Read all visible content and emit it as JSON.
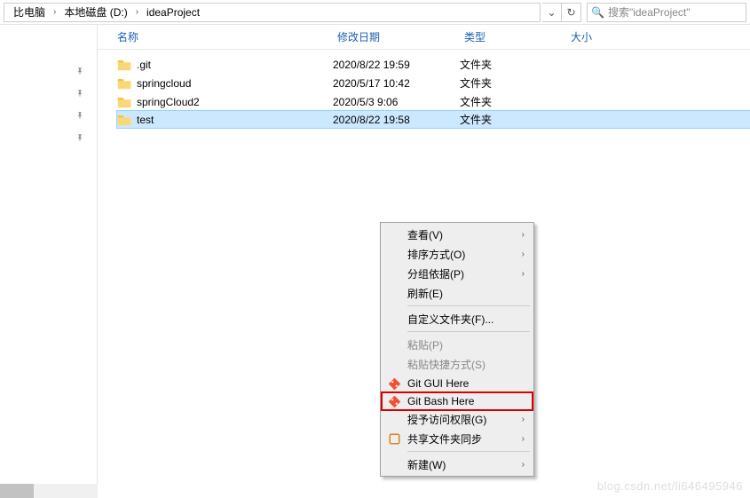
{
  "breadcrumbs": {
    "pc": "比电脑",
    "drive": "本地磁盘 (D:)",
    "folder": "ideaProject"
  },
  "search": {
    "placeholder": "搜索\"ideaProject\""
  },
  "headers": {
    "name": "名称",
    "date": "修改日期",
    "type": "类型",
    "size": "大小"
  },
  "files": [
    {
      "name": ".git",
      "date": "2020/8/22 19:59",
      "type": "文件夹"
    },
    {
      "name": "springcloud",
      "date": "2020/5/17 10:42",
      "type": "文件夹"
    },
    {
      "name": "springCloud2",
      "date": "2020/5/3 9:06",
      "type": "文件夹"
    },
    {
      "name": "test",
      "date": "2020/8/22 19:58",
      "type": "文件夹"
    }
  ],
  "ctx": {
    "view": "查看(V)",
    "sort": "排序方式(O)",
    "group": "分组依据(P)",
    "refresh": "刷新(E)",
    "customize": "自定义文件夹(F)...",
    "paste": "粘贴(P)",
    "paste_shortcut": "粘贴快捷方式(S)",
    "git_gui": "Git GUI Here",
    "git_bash": "Git Bash Here",
    "grant_access": "授予访问权限(G)",
    "sync": "共享文件夹同步",
    "new": "新建(W)"
  },
  "watermark": "blog.csdn.net/li646495946"
}
